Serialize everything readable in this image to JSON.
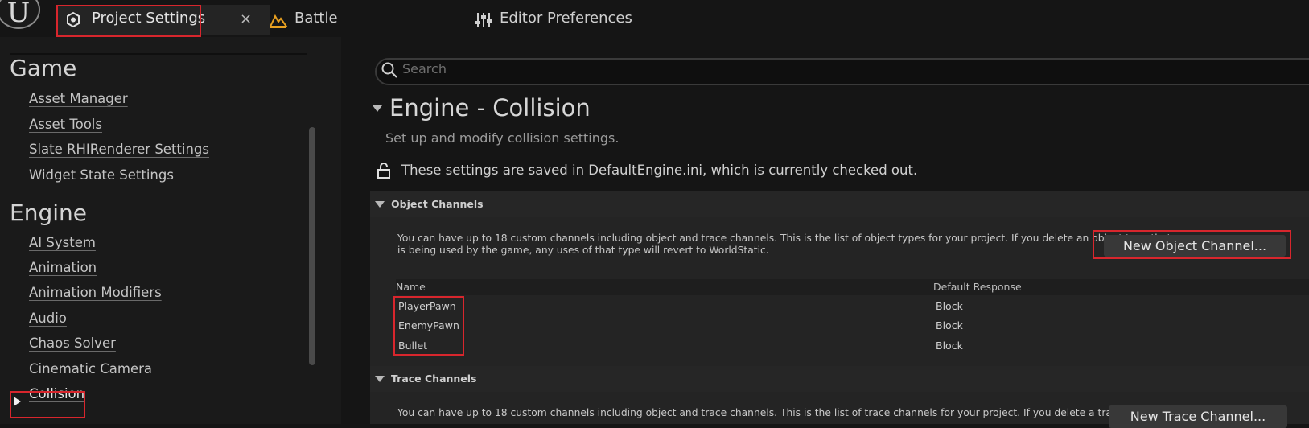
{
  "tabs": [
    {
      "label": "Project Settings",
      "close": "×"
    },
    {
      "label": "Battle"
    },
    {
      "label": "Editor Preferences"
    }
  ],
  "logo_text": "U",
  "sidebar": {
    "sections": [
      {
        "title": "Game",
        "items": [
          "Asset Manager",
          "Asset Tools",
          "Slate RHIRenderer Settings",
          "Widget State Settings"
        ]
      },
      {
        "title": "Engine",
        "items": [
          "AI System",
          "Animation",
          "Animation Modifiers",
          "Audio",
          "Chaos Solver",
          "Cinematic Camera",
          "Collision"
        ]
      }
    ],
    "selected": "Collision"
  },
  "search": {
    "placeholder": "Search"
  },
  "page": {
    "title": "Engine - Collision",
    "description": "Set up and modify collision settings.",
    "saved_note": "These settings are saved in DefaultEngine.ini, which is currently checked out."
  },
  "object_channels": {
    "label": "Object Channels",
    "desc_line1": "You can have up to 18 custom channels including object and trace channels. This is the list of object types for your project. If you delete an object type that",
    "desc_line2": "is being used by the game, any uses of that type will revert to WorldStatic.",
    "button": "New Object Channel...",
    "columns": [
      "Name",
      "Default Response"
    ],
    "rows": [
      {
        "name": "PlayerPawn",
        "response": "Block"
      },
      {
        "name": "EnemyPawn",
        "response": "Block"
      },
      {
        "name": "Bullet",
        "response": "Block"
      }
    ]
  },
  "trace_channels": {
    "label": "Trace Channels",
    "desc_line1": "You can have up to 18 custom channels including object and trace channels. This is the list of trace channels for your project. If you delete a trace channel",
    "button": "New Trace Channel..."
  },
  "colors": {
    "highlight": "#d8262d",
    "battle_icon": "#e8a020"
  }
}
